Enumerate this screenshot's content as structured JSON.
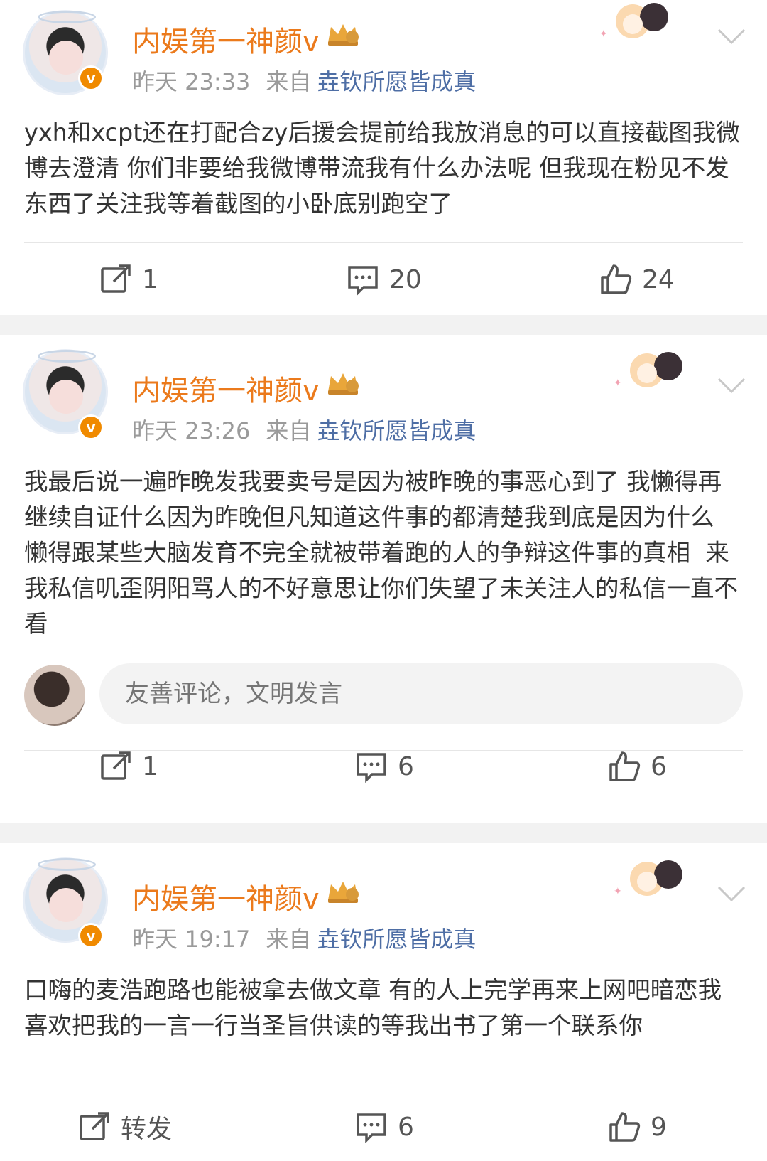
{
  "posts": [
    {
      "author": "内娱第一神颜v",
      "time": "昨天 23:33",
      "from_label": "来自",
      "from_app": "垚钦所愿皆成真",
      "text": "yxh和xcpt还在打配合zy后援会提前给我放消息的可以直接截图我微博去澄清 你们非要给我微博带流我有什么办法呢 但我现在粉见不发东西了关注我等着截图的小卧底别跑空了",
      "repost": "1",
      "comments": "20",
      "likes": "24"
    },
    {
      "author": "内娱第一神颜v",
      "time": "昨天 23:26",
      "from_label": "来自",
      "from_app": "垚钦所愿皆成真",
      "text": "我最后说一遍昨晚发我要卖号是因为被昨晚的事恶心到了 我懒得再继续自证什么因为昨晚但凡知道这件事的都清楚我到底是因为什么 懒得跟某些大脑发育不完全就被带着跑的人的争辩这件事的真相  来我私信叽歪阴阳骂人的不好意思让你们失望了未关注人的私信一直不看",
      "comment_placeholder": "友善评论，文明发言",
      "repost": "1",
      "comments": "6",
      "likes": "6"
    },
    {
      "author": "内娱第一神颜v",
      "time": "昨天 19:17",
      "from_label": "来自",
      "from_app": "垚钦所愿皆成真",
      "text": "口嗨的麦浩跑路也能被拿去做文章 有的人上完学再来上网吧暗恋我喜欢把我的一言一行当圣旨供读的等我出书了第一个联系你",
      "repost": "转发",
      "comments": "6",
      "likes": "9"
    }
  ],
  "badge_letter": "v",
  "colors": {
    "author": "#eb7a1c",
    "source_app": "#4e6ea5",
    "meta_grey": "#9a9a9a",
    "verified_badge": "#f08a00",
    "separator": "#f2f2f2"
  },
  "icons": [
    "repost-icon",
    "comment-icon",
    "like-icon",
    "chevron-down-icon",
    "crown-badge-icon",
    "verified-badge-icon"
  ]
}
